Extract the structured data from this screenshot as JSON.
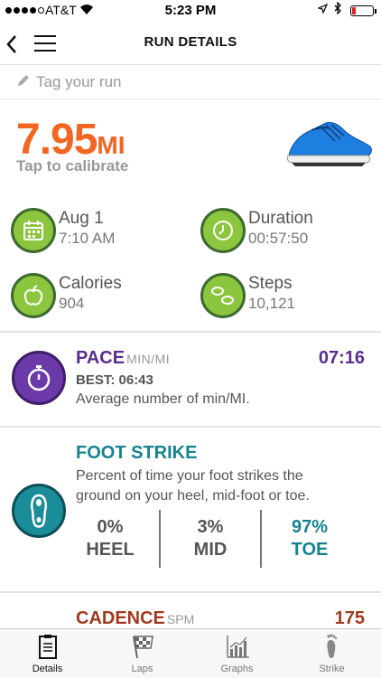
{
  "status_bar": {
    "carrier": "AT&T",
    "time": "5:23 PM"
  },
  "nav": {
    "title": "RUN DETAILS"
  },
  "tag": {
    "placeholder": "Tag your run"
  },
  "distance": {
    "value": "7.95",
    "unit": "MI",
    "calibrate_label": "Tap to calibrate"
  },
  "stats": {
    "date": {
      "label": "Aug 1",
      "value": "7:10 AM"
    },
    "duration": {
      "label": "Duration",
      "value": "00:57:50"
    },
    "calories": {
      "label": "Calories",
      "value": "904"
    },
    "steps": {
      "label": "Steps",
      "value": "10,121"
    }
  },
  "pace": {
    "title": "PACE",
    "unit": "MIN/MI",
    "value": "07:16",
    "best": "BEST: 06:43",
    "description": "Average number of min/MI.",
    "color": "#5b2d8e"
  },
  "foot_strike": {
    "title": "FOOT STRIKE",
    "description": "Percent of time your foot strikes the ground on your heel, mid-foot or toe.",
    "columns": [
      {
        "pct": "0%",
        "name": "HEEL"
      },
      {
        "pct": "3%",
        "name": "MID"
      },
      {
        "pct": "97%",
        "name": "TOE"
      }
    ],
    "color": "#16838f"
  },
  "cadence": {
    "title": "CADENCE",
    "unit": "SPM",
    "value": "175",
    "color": "#a03a1f"
  },
  "tabs": [
    {
      "label": "Details",
      "icon": "clipboard-icon",
      "active": true
    },
    {
      "label": "Laps",
      "icon": "checkered-flag-icon",
      "active": false
    },
    {
      "label": "Graphs",
      "icon": "bar-graph-icon",
      "active": false
    },
    {
      "label": "Strike",
      "icon": "footprint-icon",
      "active": false
    }
  ],
  "colors": {
    "accent": "#f26522",
    "stat_icon": "#8cc63f"
  }
}
